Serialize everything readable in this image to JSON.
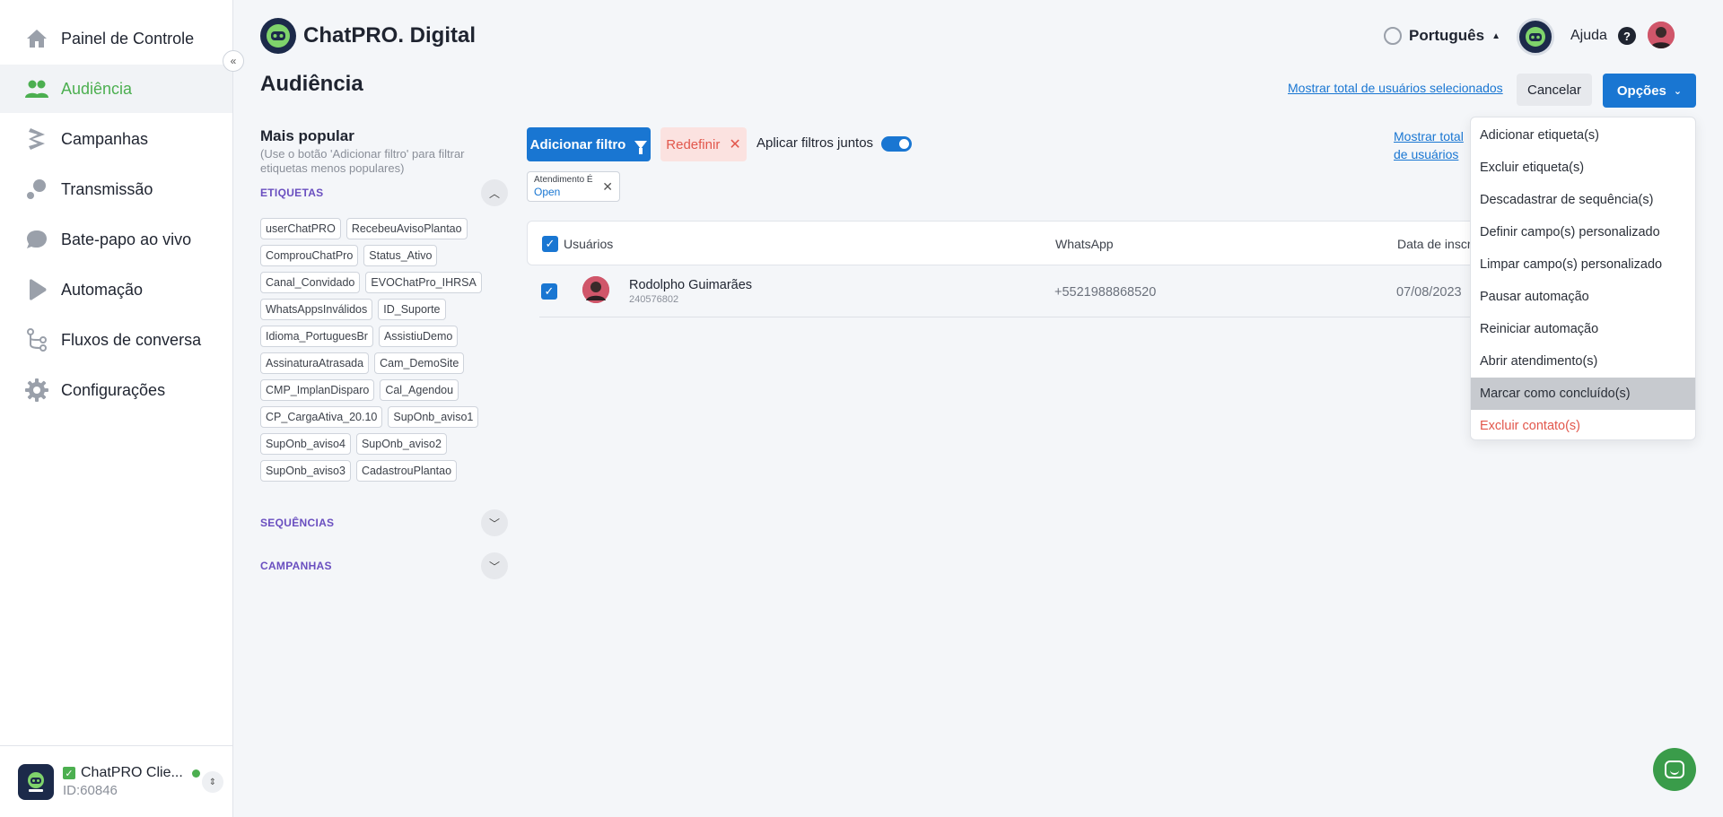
{
  "sidebar": {
    "items": [
      {
        "label": "Painel de Controle",
        "icon": "home-icon"
      },
      {
        "label": "Audiência",
        "icon": "people-icon",
        "active": true
      },
      {
        "label": "Campanhas",
        "icon": "campaign-icon"
      },
      {
        "label": "Transmissão",
        "icon": "broadcast-icon"
      },
      {
        "label": "Bate-papo ao vivo",
        "icon": "chat-bubble-icon"
      },
      {
        "label": "Automação",
        "icon": "play-icon"
      },
      {
        "label": "Fluxos de conversa",
        "icon": "flow-icon"
      },
      {
        "label": "Configurações",
        "icon": "gear-icon"
      }
    ],
    "account": {
      "name": "ChatPRO Clie...",
      "id": "ID:60846",
      "logo_text": "ChatPRO"
    }
  },
  "header": {
    "brand": "ChatPRO. Digital",
    "language": "Português",
    "help": "Ajuda",
    "help_glyph": "?"
  },
  "page": {
    "title": "Audiência",
    "show_total_selected": "Mostrar total de usuários selecionados",
    "cancel": "Cancelar",
    "options": "Opções"
  },
  "filters": {
    "popular_title": "Mais popular",
    "popular_sub": "(Use o botão 'Adicionar filtro' para filtrar etiquetas menos populares)",
    "tags_section": "ETIQUETAS",
    "sequences_section": "SEQUÊNCIAS",
    "campaigns_section": "CAMPANHAS",
    "tags": [
      "userChatPRO",
      "RecebeuAvisoPlantao",
      "ComprouChatPro",
      "Status_Ativo",
      "Canal_Convidado",
      "EVOChatPro_IHRSA",
      "WhatsAppsInválidos",
      "ID_Suporte",
      "Idioma_PortuguesBr",
      "AssistiuDemo",
      "AssinaturaAtrasada",
      "Cam_DemoSite",
      "CMP_ImplanDisparo",
      "Cal_Agendou",
      "CP_CargaAtiva_20.10",
      "SupOnb_aviso1",
      "SupOnb_aviso4",
      "SupOnb_aviso2",
      "SupOnb_aviso3",
      "CadastrouPlantao"
    ],
    "add_filter": "Adicionar filtro",
    "reset": "Redefinir",
    "apply_together": "Aplicar filtros juntos",
    "show_total_filtered": "Mostrar total de usuários filtrados",
    "chip": {
      "key": "Atendimento É",
      "value": "Open"
    }
  },
  "table": {
    "columns": [
      "Usuários",
      "WhatsApp",
      "Data de inscrição"
    ],
    "rows": [
      {
        "name": "Rodolpho Guimarães",
        "id": "240576802",
        "phone": "+5521988868520",
        "date": "07/08/2023"
      }
    ]
  },
  "options_menu": [
    "Adicionar etiqueta(s)",
    "Excluir etiqueta(s)",
    "Descadastrar de sequência(s)",
    "Definir campo(s) personalizado",
    "Limpar campo(s) personalizado",
    "Pausar automação",
    "Reiniciar automação",
    "Abrir atendimento(s)",
    "Marcar como concluído(s)",
    "Excluir contato(s)"
  ],
  "colors": {
    "accent": "#1976d2",
    "active_nav": "#4caf50",
    "danger": "#e2574c",
    "brand_dark": "#1c2a4a"
  }
}
